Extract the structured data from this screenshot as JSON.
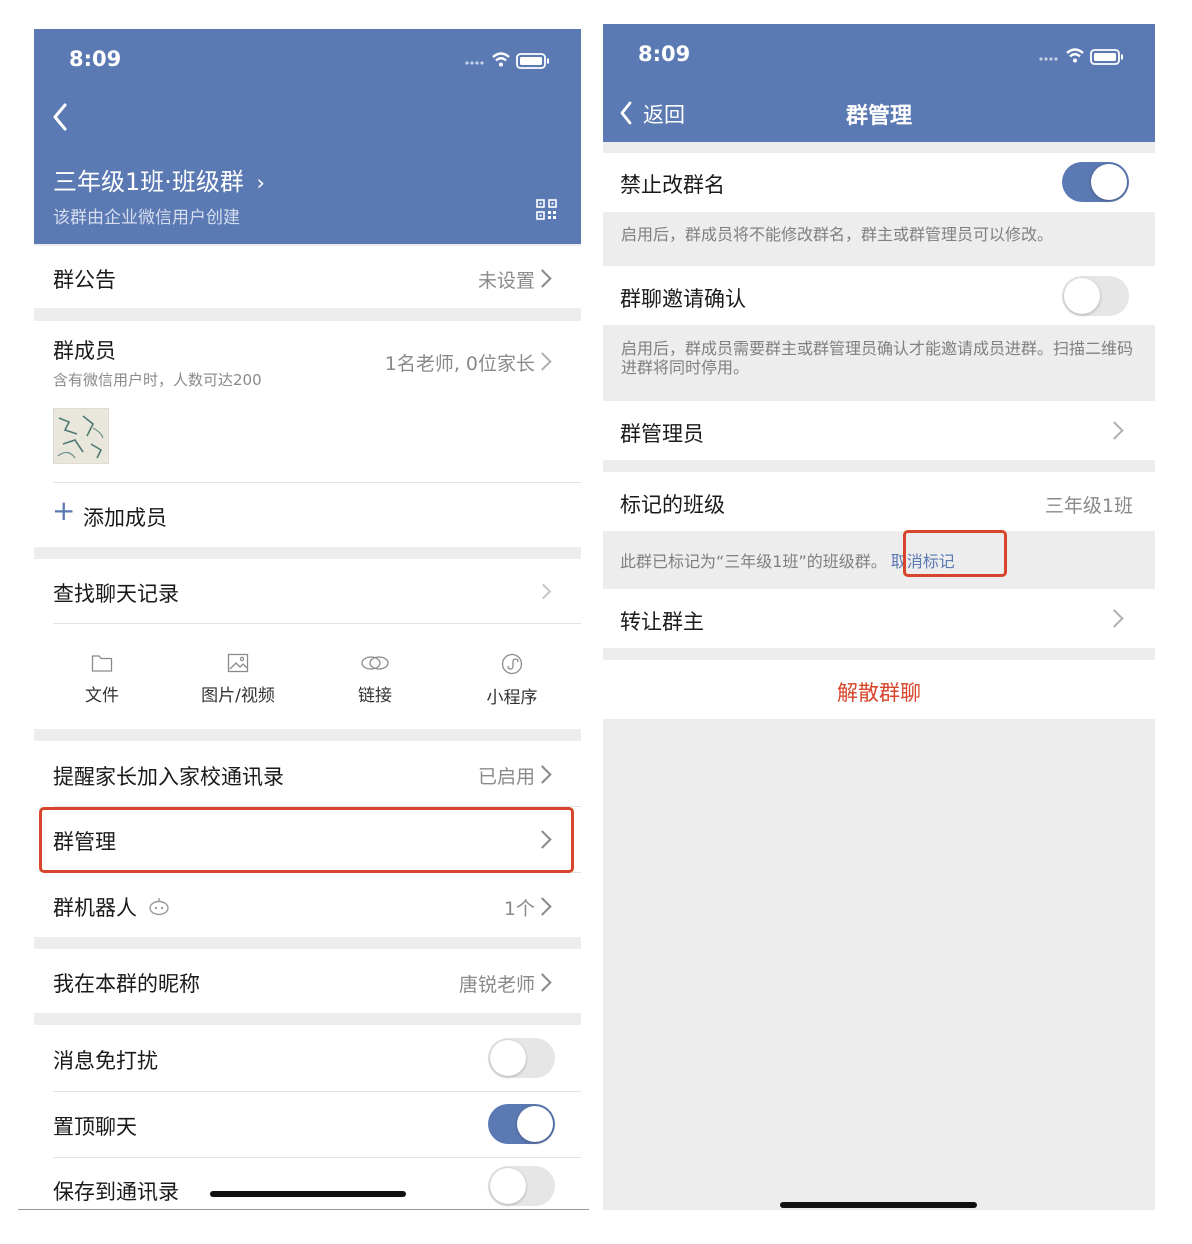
{
  "colors": {
    "header": "#5b79b2",
    "accent": "#5b79b2",
    "danger": "#d6452c",
    "toggle_on": "#5b79b2",
    "toggle_off": "#e6e6e6"
  },
  "left": {
    "time": "8:09",
    "group_title": "三年级1班·班级群",
    "group_subtitle": "该群由企业微信用户创建",
    "announcement": {
      "label": "群公告",
      "value": "未设置"
    },
    "members": {
      "label": "群成员",
      "sub": "含有微信用户时，人数可达200",
      "value": "1名老师, 0位家长"
    },
    "add_member": "添加成员",
    "search_history": "查找聊天记录",
    "tiles": [
      {
        "label": "文件",
        "icon": "folder-icon"
      },
      {
        "label": "图片/视频",
        "icon": "image-icon"
      },
      {
        "label": "链接",
        "icon": "link-icon"
      },
      {
        "label": "小程序",
        "icon": "mini-program-icon"
      }
    ],
    "remind_parents": {
      "label": "提醒家长加入家校通讯录",
      "value": "已启用"
    },
    "group_manage": "群管理",
    "group_robot": {
      "label": "群机器人",
      "value": "1个"
    },
    "my_nickname": {
      "label": "我在本群的昵称",
      "value": "唐锐老师"
    },
    "mute": {
      "label": "消息免打扰",
      "on": false
    },
    "pin": {
      "label": "置顶聊天",
      "on": true
    },
    "save_contacts": {
      "label": "保存到通讯录",
      "on": false
    }
  },
  "right": {
    "time": "8:09",
    "back": "返回",
    "title": "群管理",
    "forbid_rename": {
      "label": "禁止改群名",
      "on": true,
      "note": "启用后，群成员将不能修改群名，群主或群管理员可以修改。"
    },
    "invite_confirm": {
      "label": "群聊邀请确认",
      "on": false,
      "note": "启用后，群成员需要群主或群管理员确认才能邀请成员进群。扫描二维码进群将同时停用。"
    },
    "admins": "群管理员",
    "marked_class": {
      "label": "标记的班级",
      "value": "三年级1班"
    },
    "marked_note": "此群已标记为“三年级1班”的班级群。",
    "unmark": "取消标记",
    "transfer_owner": "转让群主",
    "dismiss": "解散群聊"
  }
}
